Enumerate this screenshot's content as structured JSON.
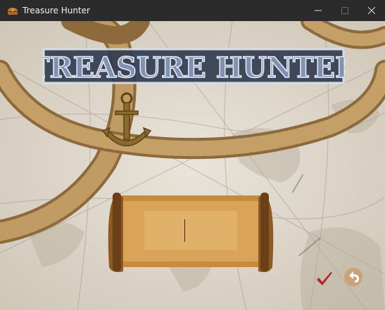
{
  "window": {
    "title": "Treasure Hunter",
    "minimize_icon": "minimize-icon",
    "maximize_icon": "maximize-icon",
    "close_icon": "close-icon"
  },
  "game": {
    "logo_text": "TREASURE HUNTER",
    "name_input": {
      "value": "",
      "placeholder": ""
    },
    "confirm_icon": "checkmark-icon",
    "back_icon": "undo-arrow-icon"
  },
  "colors": {
    "titlebar": "#2b2b2b",
    "map_paper": "#e3ddd2",
    "rope": "#b7905a",
    "scroll": "#c68a3a",
    "logo_fill": "#5d6f8c",
    "confirm_red": "#b3262b",
    "back_button": "#caa27a"
  }
}
